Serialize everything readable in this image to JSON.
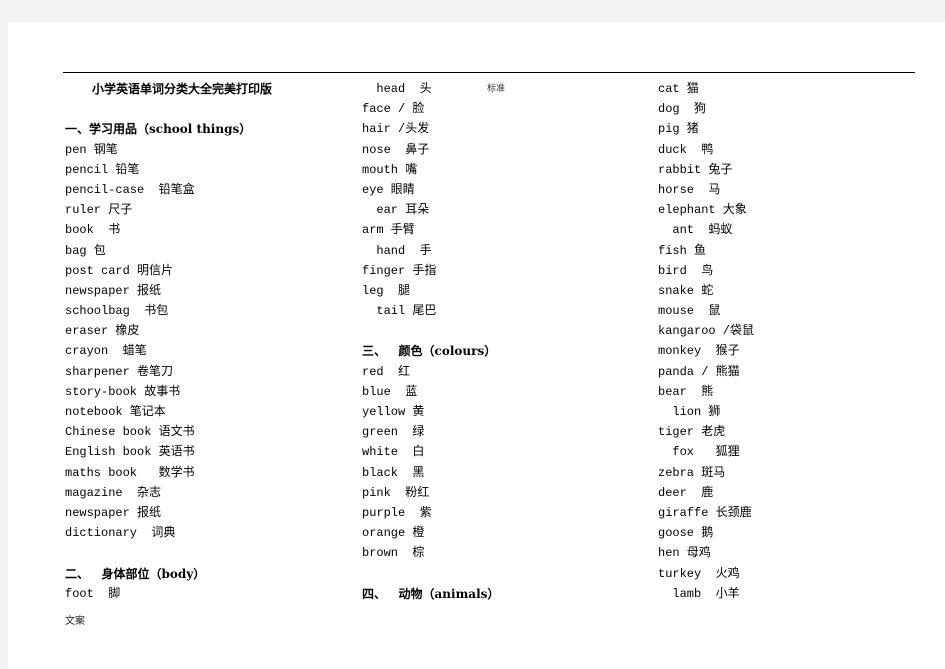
{
  "header": {
    "text": "标准"
  },
  "footer": {
    "text": "文案"
  },
  "document": {
    "title": "小学英语单词分类大全完美打印版",
    "columns": [
      {
        "lines": [
          {
            "type": "title",
            "text": "小学英语单词分类大全完美打印版"
          },
          {
            "type": "blank",
            "text": ""
          },
          {
            "type": "heading",
            "text": "一、学习用品（school things）"
          },
          {
            "type": "word",
            "text": "pen 钢笔"
          },
          {
            "type": "word",
            "text": "pencil 铅笔"
          },
          {
            "type": "word",
            "text": "pencil-case  铅笔盒"
          },
          {
            "type": "word",
            "text": "ruler 尺子"
          },
          {
            "type": "word",
            "text": "book  书"
          },
          {
            "type": "word",
            "text": "bag 包"
          },
          {
            "type": "word",
            "text": "post card 明信片"
          },
          {
            "type": "word",
            "text": "newspaper 报纸"
          },
          {
            "type": "word",
            "text": "schoolbag  书包"
          },
          {
            "type": "word",
            "text": "eraser 橡皮"
          },
          {
            "type": "word",
            "text": "crayon  蜡笔"
          },
          {
            "type": "word",
            "text": "sharpener 卷笔刀"
          },
          {
            "type": "word",
            "text": "story-book 故事书"
          },
          {
            "type": "word",
            "text": "notebook 笔记本"
          },
          {
            "type": "word",
            "text": "Chinese book 语文书"
          },
          {
            "type": "word",
            "text": "English book 英语书"
          },
          {
            "type": "word",
            "text": "maths book   数学书"
          },
          {
            "type": "word",
            "text": "magazine  杂志"
          },
          {
            "type": "word",
            "text": "newspaper 报纸"
          },
          {
            "type": "word",
            "text": "dictionary  词典"
          },
          {
            "type": "blank",
            "text": ""
          },
          {
            "type": "heading",
            "text": "二、   身体部位（body）"
          },
          {
            "type": "word",
            "text": "foot  脚"
          }
        ]
      },
      {
        "lines": [
          {
            "type": "word",
            "text": "  head  头"
          },
          {
            "type": "word",
            "text": "face / 脸"
          },
          {
            "type": "word",
            "text": "hair /头发"
          },
          {
            "type": "word",
            "text": "nose  鼻子"
          },
          {
            "type": "word",
            "text": "mouth 嘴"
          },
          {
            "type": "word",
            "text": "eye 眼睛"
          },
          {
            "type": "word",
            "text": "  ear 耳朵"
          },
          {
            "type": "word",
            "text": "arm 手臂"
          },
          {
            "type": "word",
            "text": "  hand  手"
          },
          {
            "type": "word",
            "text": "finger 手指"
          },
          {
            "type": "word",
            "text": "leg  腿"
          },
          {
            "type": "word",
            "text": "  tail 尾巴"
          },
          {
            "type": "blank",
            "text": ""
          },
          {
            "type": "heading",
            "text": "三、   颜色（colours）"
          },
          {
            "type": "word",
            "text": "red  红"
          },
          {
            "type": "word",
            "text": "blue  蓝"
          },
          {
            "type": "word",
            "text": "yellow 黄"
          },
          {
            "type": "word",
            "text": "green  绿"
          },
          {
            "type": "word",
            "text": "white  白"
          },
          {
            "type": "word",
            "text": "black  黑"
          },
          {
            "type": "word",
            "text": "pink  粉红"
          },
          {
            "type": "word",
            "text": "purple  紫"
          },
          {
            "type": "word",
            "text": "orange 橙"
          },
          {
            "type": "word",
            "text": "brown  棕"
          },
          {
            "type": "blank",
            "text": ""
          },
          {
            "type": "heading",
            "text": "四、   动物（animals）"
          }
        ]
      },
      {
        "lines": [
          {
            "type": "word",
            "text": "cat 猫"
          },
          {
            "type": "word",
            "text": "dog  狗"
          },
          {
            "type": "word",
            "text": "pig 猪"
          },
          {
            "type": "word",
            "text": "duck  鸭"
          },
          {
            "type": "word",
            "text": "rabbit 兔子"
          },
          {
            "type": "word",
            "text": "horse  马"
          },
          {
            "type": "word",
            "text": "elephant 大象"
          },
          {
            "type": "word",
            "text": "  ant  蚂蚁"
          },
          {
            "type": "word",
            "text": "fish 鱼"
          },
          {
            "type": "word",
            "text": "bird  鸟"
          },
          {
            "type": "word",
            "text": "snake 蛇"
          },
          {
            "type": "word",
            "text": "mouse  鼠"
          },
          {
            "type": "word",
            "text": "kangaroo /袋鼠"
          },
          {
            "type": "word",
            "text": "monkey  猴子"
          },
          {
            "type": "word",
            "text": "panda / 熊猫"
          },
          {
            "type": "word",
            "text": "bear  熊"
          },
          {
            "type": "word",
            "text": "  lion 狮"
          },
          {
            "type": "word",
            "text": "tiger 老虎"
          },
          {
            "type": "word",
            "text": "  fox   狐狸"
          },
          {
            "type": "word",
            "text": "zebra 斑马"
          },
          {
            "type": "word",
            "text": "deer  鹿"
          },
          {
            "type": "word",
            "text": "giraffe 长颈鹿"
          },
          {
            "type": "word",
            "text": "goose 鹅"
          },
          {
            "type": "word",
            "text": "hen 母鸡"
          },
          {
            "type": "word",
            "text": "turkey  火鸡"
          },
          {
            "type": "word",
            "text": "  lamb  小羊"
          }
        ]
      }
    ]
  }
}
